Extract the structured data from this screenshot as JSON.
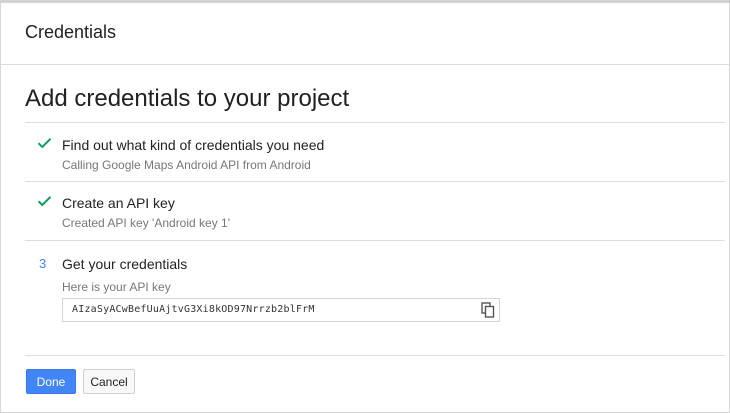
{
  "header": {
    "title": "Credentials"
  },
  "page": {
    "title": "Add credentials to your project"
  },
  "steps": [
    {
      "marker": "check",
      "title": "Find out what kind of credentials you need",
      "subtitle": "Calling Google Maps Android API from Android"
    },
    {
      "marker": "check",
      "title": "Create an API key",
      "subtitle": "Created API key 'Android key 1'"
    },
    {
      "marker": "3",
      "title": "Get your credentials",
      "subtitle": "Here is your API key"
    }
  ],
  "api_key": {
    "value": "AIzaSyACwBefUuAjtvG3Xi8kOD97Nrrzb2blFrM",
    "copy_icon": "copy-icon"
  },
  "actions": {
    "done_label": "Done",
    "cancel_label": "Cancel"
  },
  "colors": {
    "accent": "#4285f4",
    "check": "#0f9d58"
  }
}
